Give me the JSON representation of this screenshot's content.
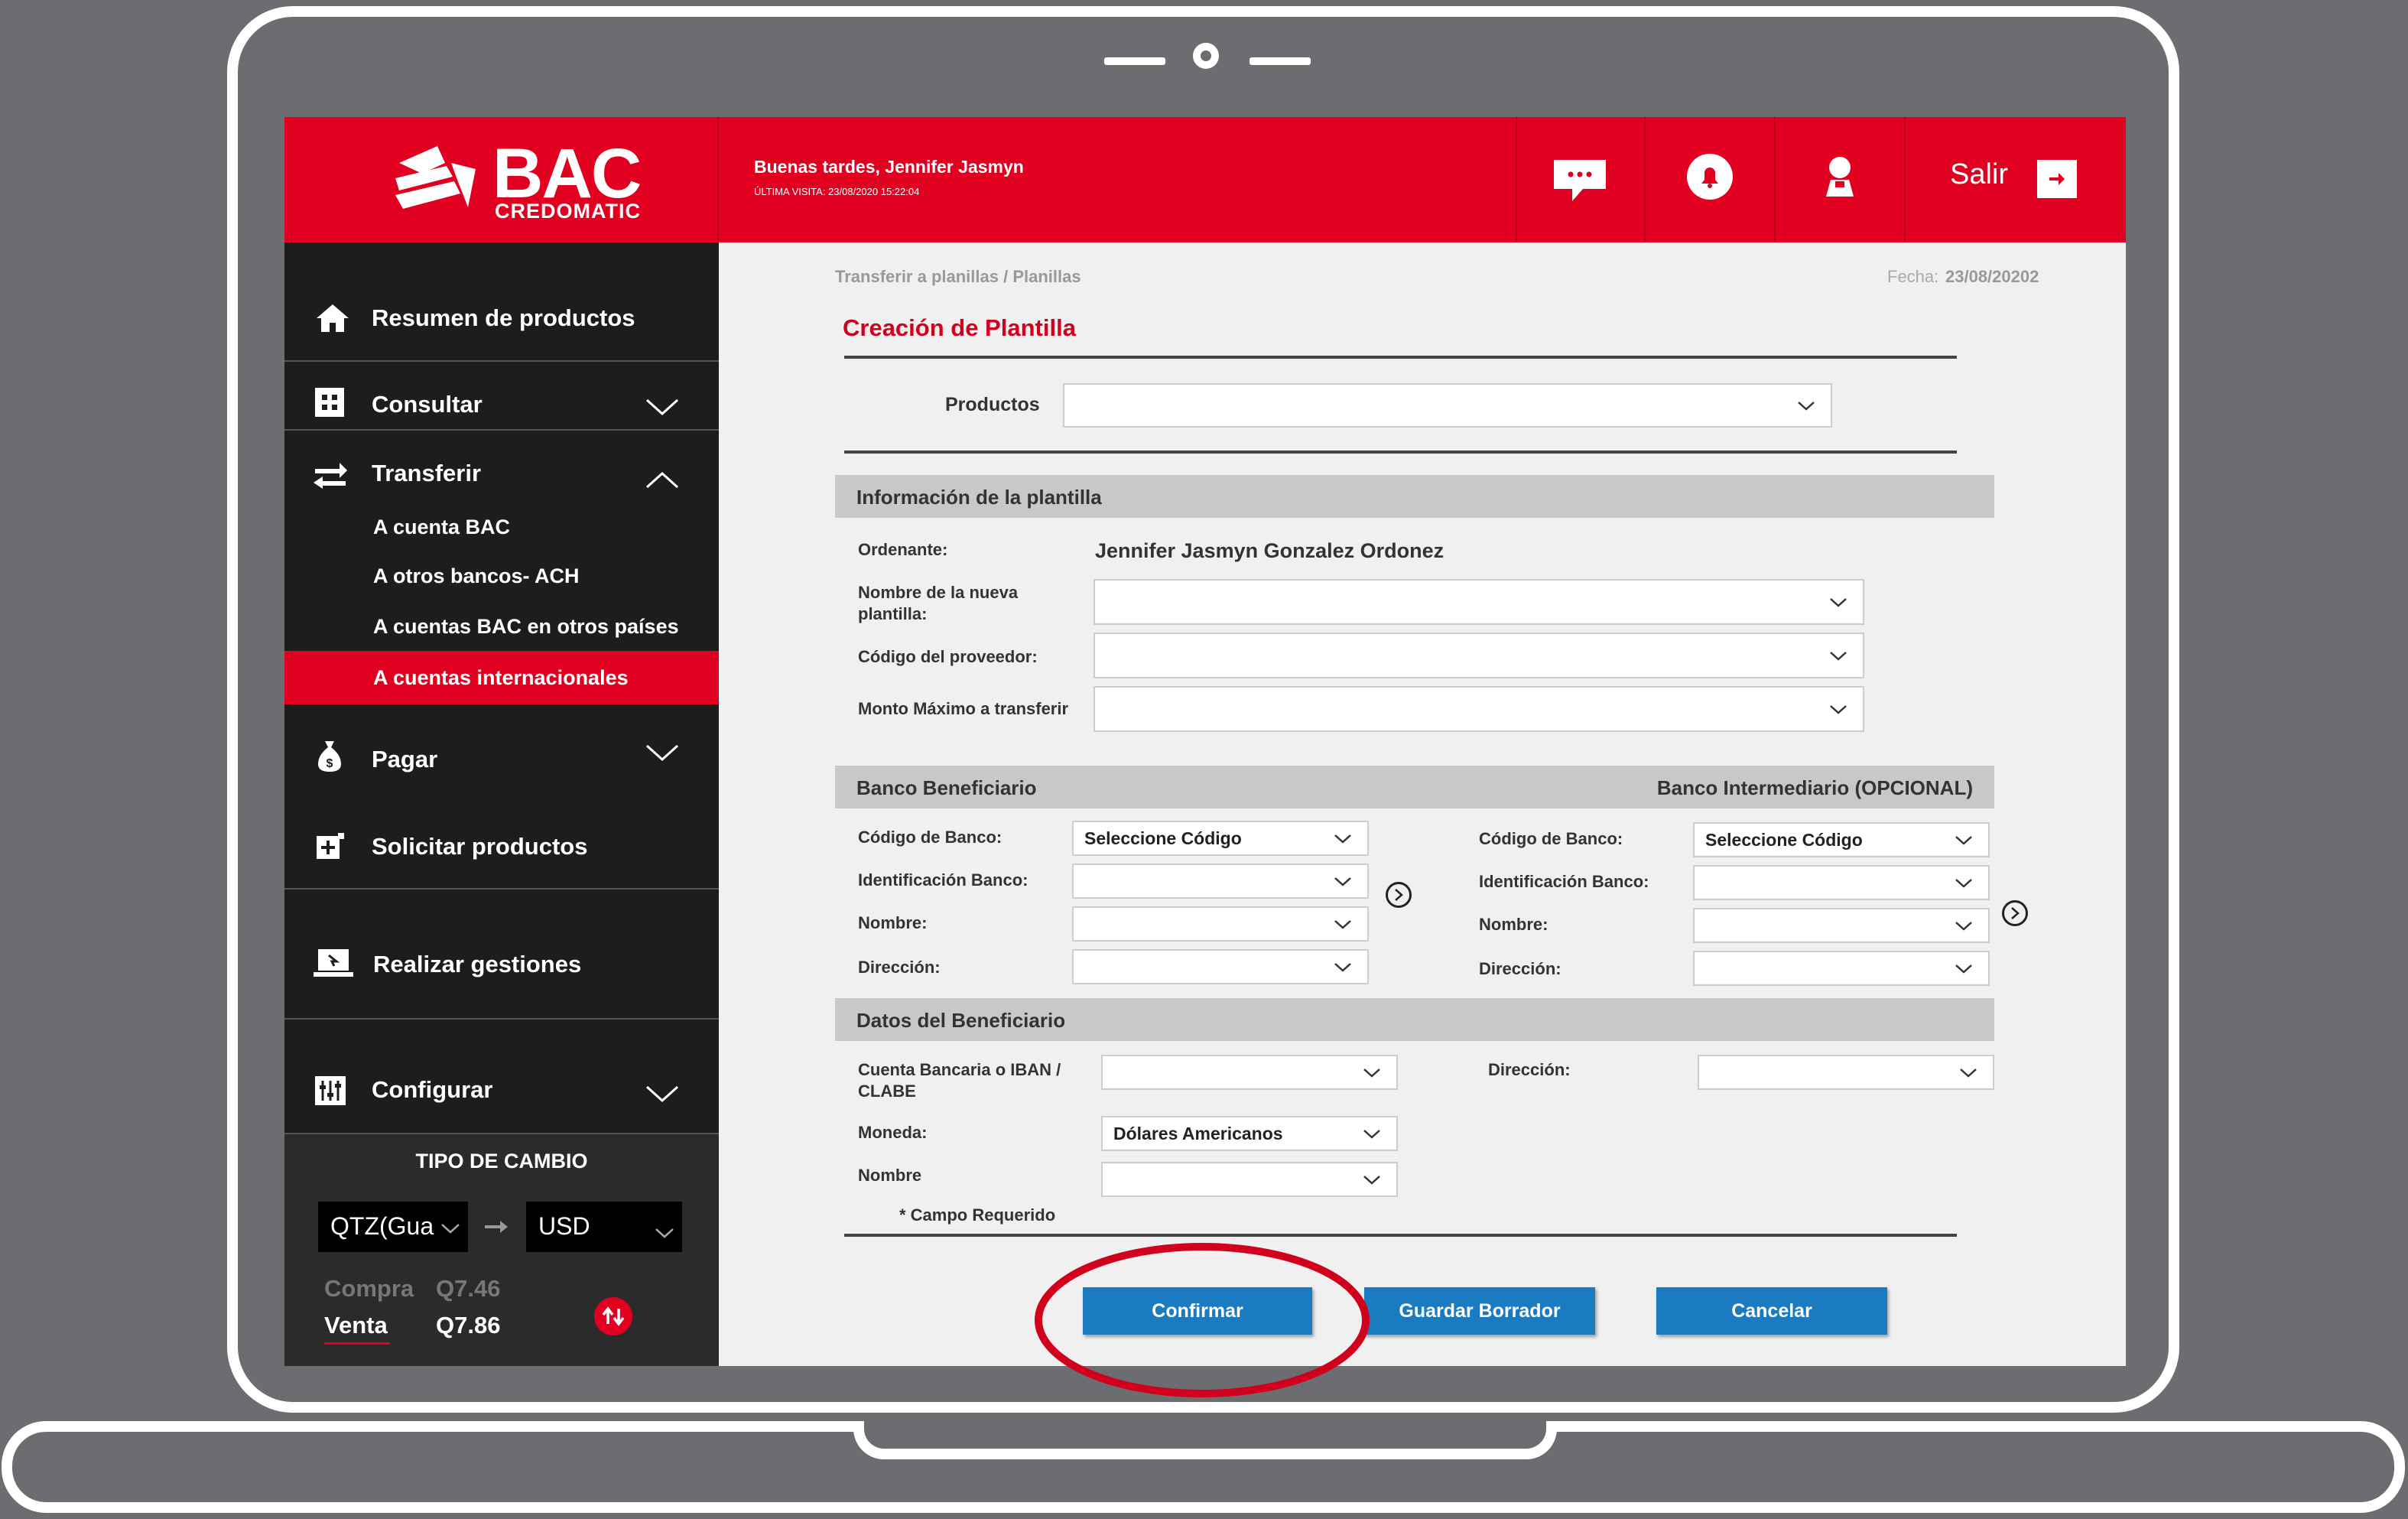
{
  "brand": {
    "name": "BAC",
    "sub": "CREDOMATIC"
  },
  "header": {
    "greeting": "Buenas tardes, Jennifer Jasmyn",
    "last_visit": "ÚLTIMA VISITA: 23/08/2020 15:22:04",
    "logout": "Salir"
  },
  "sidebar": {
    "items": [
      "Resumen de productos",
      "Consultar",
      "Transferir",
      "Pagar",
      "Solicitar productos",
      "Realizar gestiones",
      "Configurar"
    ],
    "transfer_sub": [
      "A cuenta BAC",
      "A otros bancos- ACH",
      "A cuentas BAC en otros países",
      "A cuentas internacionales"
    ]
  },
  "exchange": {
    "title": "TIPO DE CAMBIO",
    "from": "QTZ(Gua",
    "to": "USD",
    "buy_label": "Compra",
    "buy_value": "Q7.46",
    "sell_label": "Venta",
    "sell_value": "Q7.86"
  },
  "breadcrumb": "Transferir a planillas / Planillas",
  "date": {
    "label": "Fecha:",
    "value": "23/08/20202"
  },
  "page_title": "Creación de Plantilla",
  "products_label": "Productos",
  "info": {
    "title": "Información de la plantilla",
    "ordenante_label": "Ordenante:",
    "ordenante_value": "Jennifer Jasmyn Gonzalez Ordonez",
    "name_label": "Nombre de la nueva plantilla:",
    "provider_label": "Código del proveedor:",
    "max_label": "Monto Máximo a transferir"
  },
  "banks": {
    "beneficiary_title": "Banco Beneficiario",
    "intermediary_title": "Banco Intermediario (OPCIONAL)",
    "code_label": "Código de Banco:",
    "code_value": "Seleccione Código",
    "id_label": "Identificación Banco:",
    "name_label": "Nombre:",
    "address_label": "Dirección:"
  },
  "beneficiary": {
    "title": "Datos del Beneficiario",
    "account_label": "Cuenta Bancaria o IBAN / CLABE",
    "address_label": "Dirección:",
    "currency_label": "Moneda:",
    "currency_value": "Dólares Americanos",
    "name_label": "Nombre",
    "required_note": "* Campo Requerido"
  },
  "buttons": {
    "confirm": "Confirmar",
    "draft": "Guardar Borrador",
    "cancel": "Cancelar"
  },
  "colors": {
    "brand_red": "#e1001f",
    "button_blue": "#1a7bc1",
    "sidebar": "#1d1d1d"
  }
}
